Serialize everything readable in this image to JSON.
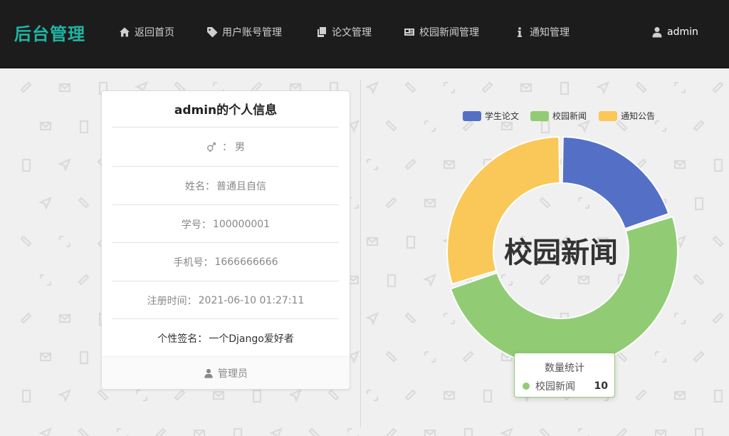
{
  "navbar": {
    "brand": "后台管理",
    "items": [
      {
        "label": "返回首页",
        "icon": "home-icon"
      },
      {
        "label": "用户账号管理",
        "icon": "tag-icon"
      },
      {
        "label": "论文管理",
        "icon": "copy-icon"
      },
      {
        "label": "校园新闻管理",
        "icon": "newspaper-icon"
      },
      {
        "label": "通知管理",
        "icon": "info-icon"
      }
    ],
    "user": {
      "label": "admin",
      "icon": "user-icon"
    }
  },
  "profile": {
    "title": "admin的个人信息",
    "gender_icon": "gender-icon",
    "gender_sep": "：",
    "gender": "男",
    "rows": [
      {
        "label": "姓名：",
        "value": "普通且自信"
      },
      {
        "label": "学号：",
        "value": "100000001"
      },
      {
        "label": "手机号：",
        "value": "1666666666"
      },
      {
        "label": "注册时间：",
        "value": "2021-06-10 01:27:11"
      },
      {
        "label": "个性签名：",
        "value": "一个Django爱好者"
      }
    ],
    "role": "管理员",
    "role_icon": "user-icon"
  },
  "chart_data": {
    "type": "pie",
    "subtype": "donut",
    "categories": [
      "学生论文",
      "校园新闻",
      "通知公告"
    ],
    "values": [
      4,
      10,
      6
    ],
    "colors": [
      "#5470c6",
      "#91cc75",
      "#fac858"
    ],
    "legend_position": "top-right",
    "center_label": "校园新闻",
    "tooltip": {
      "title": "数量统计",
      "name": "校园新闻",
      "value": "10"
    }
  }
}
